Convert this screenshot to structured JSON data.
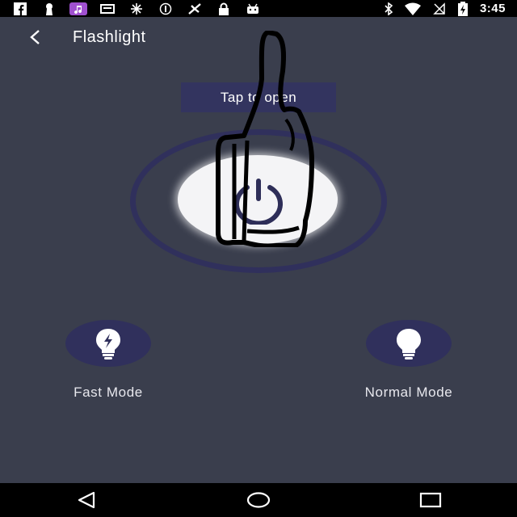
{
  "status_bar": {
    "time": "3:45",
    "left_icons": [
      "facebook-icon",
      "keyhole-icon",
      "music-icon",
      "storage-icon",
      "brightness-icon",
      "data-saver-icon",
      "fan-icon",
      "lock-icon",
      "android-icon"
    ],
    "right_icons": [
      "bluetooth-icon",
      "wifi-icon",
      "no-sim-icon",
      "battery-charging-icon"
    ]
  },
  "header": {
    "title": "Flashlight",
    "back_icon": "chevron-left-icon"
  },
  "power": {
    "hint": "Tap to open",
    "icon": "power-icon"
  },
  "modes": {
    "fast": {
      "label": "Fast Mode",
      "icon": "bulb-flash-icon"
    },
    "normal": {
      "label": "Normal Mode",
      "icon": "bulb-icon"
    }
  },
  "nav_bar": {
    "buttons": [
      "back-triangle-icon",
      "home-circle-icon",
      "recents-square-icon"
    ]
  },
  "colors": {
    "background": "#3a3e4d",
    "accent": "#30305c",
    "button_white": "#f4f4f6"
  }
}
